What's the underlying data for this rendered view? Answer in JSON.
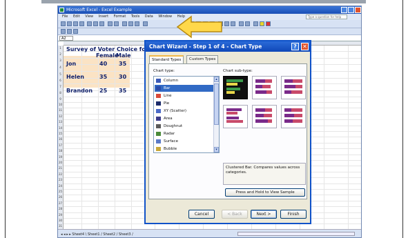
{
  "window": {
    "title": "Microsoft Excel - Excel Example",
    "menu": [
      "File",
      "Edit",
      "View",
      "Insert",
      "Format",
      "Tools",
      "Data",
      "Window",
      "Help"
    ],
    "ask_placeholder": "Type a question for help",
    "name_box": "A2"
  },
  "sheet": {
    "title": "Survey of Voter Choice for",
    "headers": [
      "Female",
      "Male"
    ],
    "rows": [
      {
        "name": "Jon",
        "female": "40",
        "male": "35"
      },
      {
        "name": "Helen",
        "female": "35",
        "male": "30"
      },
      {
        "name": "Brandon",
        "female": "25",
        "male": "35"
      }
    ],
    "row_numbers": [
      "1",
      "2",
      "3",
      "4",
      "5",
      "6",
      "7",
      "8",
      "9",
      "10",
      "11",
      "12",
      "13",
      "14",
      "15",
      "16",
      "17",
      "18",
      "19",
      "20",
      "21",
      "22",
      "23",
      "24",
      "25",
      "26",
      "27",
      "28",
      "29",
      "30",
      "31"
    ],
    "sheet_tabs": "Sheet4 \\ Sheet1 / Sheet2 / Sheet3 /"
  },
  "dialog": {
    "title": "Chart Wizard - Step 1 of 4 - Chart Type",
    "tabs": [
      "Standard Types",
      "Custom Types"
    ],
    "chart_type_label": "Chart type:",
    "chart_subtype_label": "Chart sub-type:",
    "chart_types": [
      {
        "label": "Column",
        "icon": "column-chart-icon"
      },
      {
        "label": "Bar",
        "icon": "bar-chart-icon",
        "selected": true
      },
      {
        "label": "Line",
        "icon": "line-chart-icon"
      },
      {
        "label": "Pie",
        "icon": "pie-chart-icon"
      },
      {
        "label": "XY (Scatter)",
        "icon": "scatter-chart-icon"
      },
      {
        "label": "Area",
        "icon": "area-chart-icon"
      },
      {
        "label": "Doughnut",
        "icon": "doughnut-chart-icon"
      },
      {
        "label": "Radar",
        "icon": "radar-chart-icon"
      },
      {
        "label": "Surface",
        "icon": "surface-chart-icon"
      },
      {
        "label": "Bubble",
        "icon": "bubble-chart-icon"
      }
    ],
    "subtype_description": "Clustered Bar. Compares values across categories.",
    "press_hold_label": "Press and Hold to View Sample",
    "buttons": {
      "cancel": "Cancel",
      "back": "< Back",
      "next": "Next >",
      "finish": "Finish"
    }
  },
  "colors": {
    "dialog_title": "#1048b8",
    "highlight_cells": "#fbe3c4",
    "arrow": "#ffd84a"
  }
}
